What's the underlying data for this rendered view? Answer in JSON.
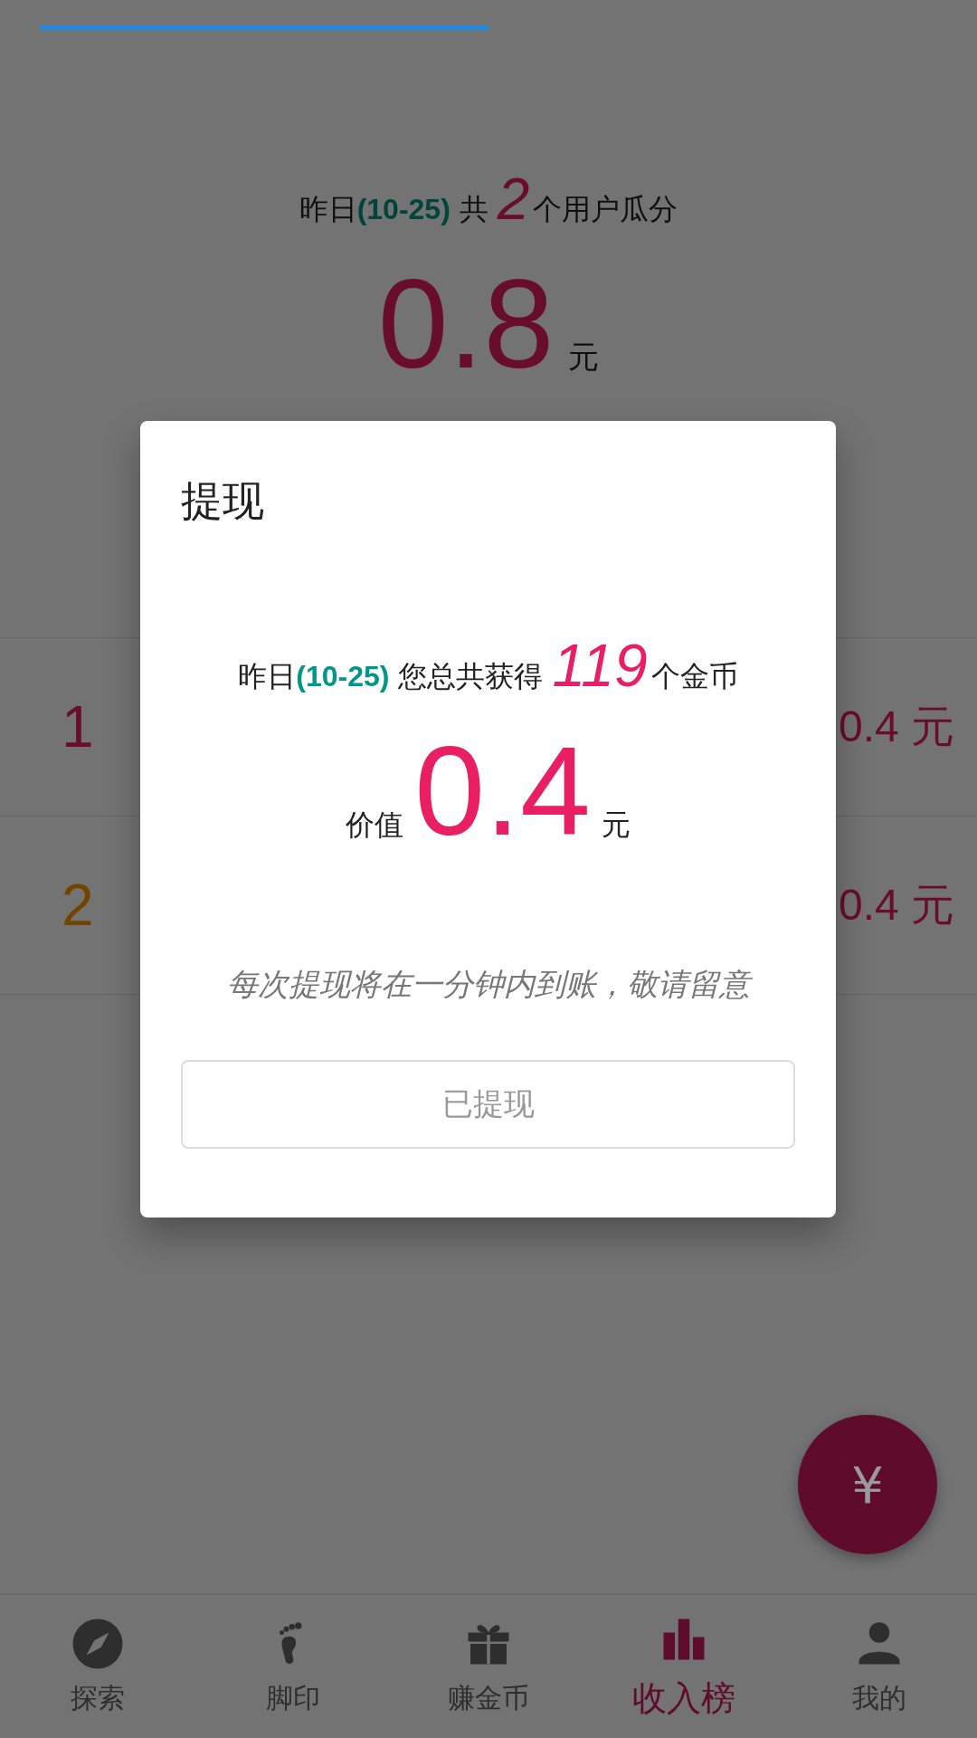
{
  "summary": {
    "prefix": "昨日",
    "date": "(10-25)",
    "middle": "共",
    "count": "2",
    "suffix": "个用户瓜分"
  },
  "total": {
    "amount": "0.8",
    "unit": "元"
  },
  "ranking": [
    {
      "rank": "1",
      "amount": "0.4 元",
      "color": "#680d2c"
    },
    {
      "rank": "2",
      "amount": "0.4 元",
      "color": "#734400"
    }
  ],
  "fab": {
    "symbol": "¥"
  },
  "nav": [
    {
      "label": "探索",
      "kind": "compass",
      "selected": false
    },
    {
      "label": "脚印",
      "kind": "footprint",
      "selected": false
    },
    {
      "label": "赚金币",
      "kind": "gift",
      "selected": false
    },
    {
      "label": "收入榜",
      "kind": "chart",
      "selected": true
    },
    {
      "label": "我的",
      "kind": "person",
      "selected": false
    }
  ],
  "dialog": {
    "title": "提现",
    "prefix": "昨日",
    "date": "(10-25)",
    "middle": "您总共获得",
    "coins": "119",
    "suffix": "个金币",
    "value_label": "价值",
    "value": "0.4",
    "unit": "元",
    "note": "每次提现将在一分钟内到账，敬请留意",
    "button": {
      "label": "已提现",
      "disabled": true
    }
  }
}
